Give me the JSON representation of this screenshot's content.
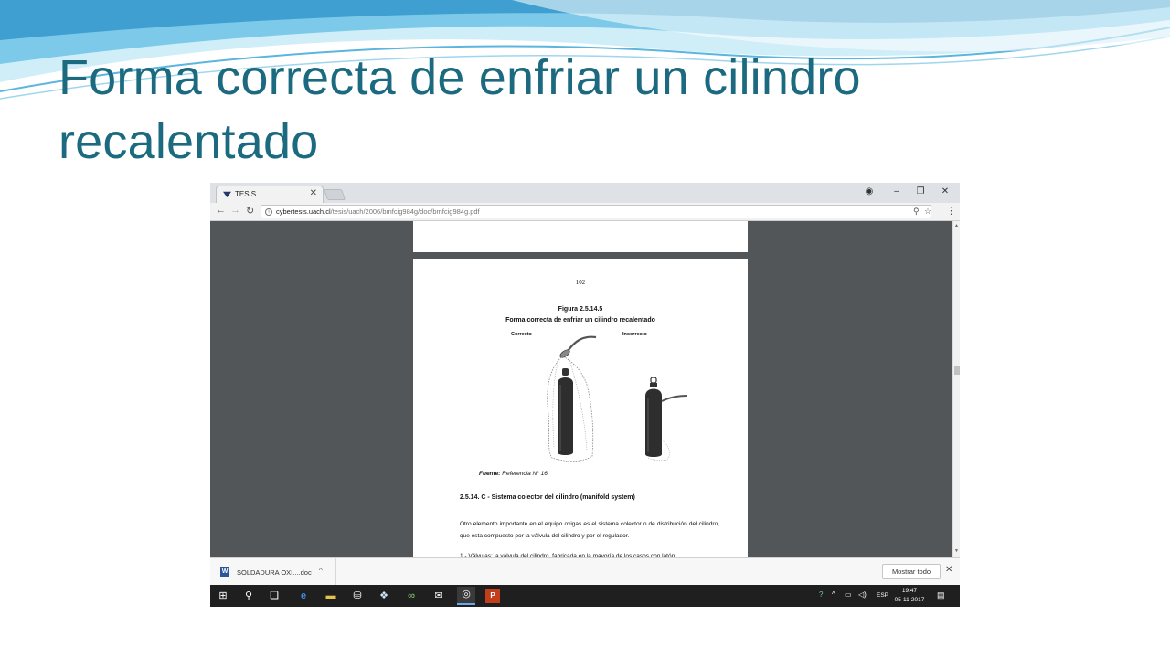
{
  "slide": {
    "title": "Forma correcta de enfriar un cilindro recalentado",
    "colors": {
      "title": "#1b6a80",
      "wave_light": "#a9dcee",
      "wave_mid": "#52b3dd",
      "wave_dark": "#2b86b7"
    }
  },
  "browser": {
    "tab_title": "TESIS",
    "url_host": "cybertesis.uach.cl",
    "url_path": "/tesis/uach/2006/bmfcig984g/doc/bmfcig984g.pdf"
  },
  "pdf_page": {
    "page_number": "102",
    "figure_number": "Figura 2.5.14.5",
    "figure_title": "Forma correcta de enfriar un cilindro recalentado",
    "label_correct": "Correcto",
    "label_incorrect": "Incorrecto",
    "source_label": "Fuente:",
    "source_text": " Referencia N° 16",
    "section_heading": "2.5.14. C - Sistema colector del cilindro (manifold system)",
    "paragraph1": "Otro elemento importante en el equipo oxigas es el sistema colector o de distribución del cilindro, que esta compuesto por la válvula del cilindro y por el regulador.",
    "paragraph2_partial": "1.- Válvulas: la válvula del cilindro, fabricada en la mayoría de los casos con latón"
  },
  "downloads": {
    "file_name": "SOLDADURA OXI....doc",
    "show_all": "Mostrar todo"
  },
  "taskbar": {
    "language": "ESP",
    "time": "19:47",
    "date": "05-11-2017"
  }
}
